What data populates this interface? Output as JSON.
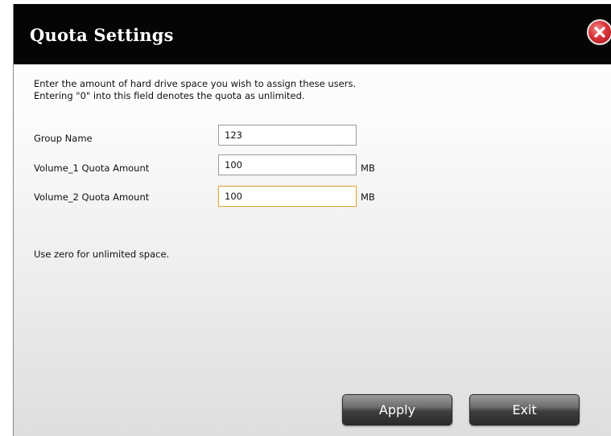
{
  "dialog": {
    "title": "Quota Settings",
    "intro_line1": "Enter the amount of hard drive space you wish to assign these users.",
    "intro_line2": "Entering \"0\" into this field denotes the quota as unlimited."
  },
  "fields": {
    "group_name": {
      "label": "Group Name",
      "value": "123"
    },
    "volume1": {
      "label": "Volume_1 Quota Amount",
      "value": "100",
      "unit": "MB"
    },
    "volume2": {
      "label": "Volume_2 Quota Amount",
      "value": "100",
      "unit": "MB"
    }
  },
  "note": "Use zero for unlimited space.",
  "buttons": {
    "apply": "Apply",
    "exit": "Exit"
  },
  "icons": {
    "close": "close-icon"
  },
  "colors": {
    "titlebar": "#050505",
    "close_button": "#d9343a",
    "focus_border": "#e0a840"
  }
}
